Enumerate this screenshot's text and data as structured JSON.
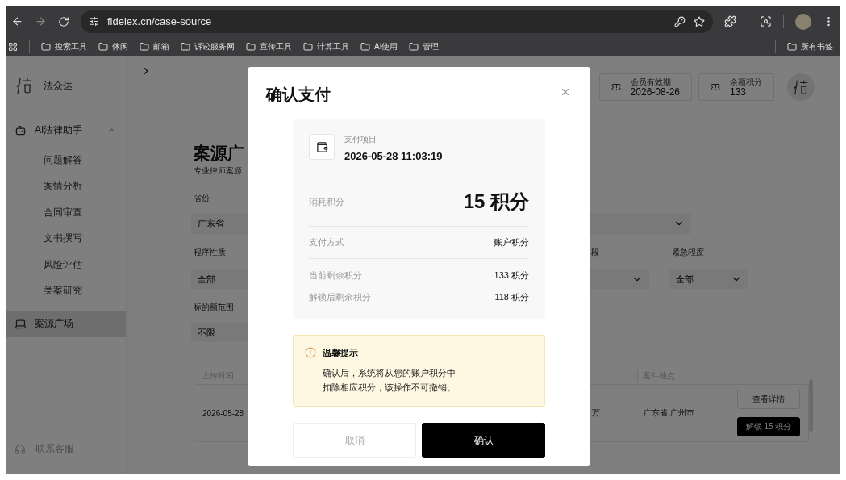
{
  "browser": {
    "url": "fidelex.cn/case-source",
    "bookmarks": [
      "搜索工具",
      "休闲",
      "邮箱",
      "诉讼服务网",
      "宣传工具",
      "计算工具",
      "AI使用",
      "管理"
    ],
    "all_bookmarks": "所有书签"
  },
  "sidebar": {
    "brand": "法众达",
    "items": [
      {
        "kind": "group",
        "label": "AI法律助手",
        "selected": false,
        "expanded": true,
        "children": [
          {
            "label": "问题解答",
            "selected": false
          },
          {
            "label": "案情分析",
            "selected": false
          },
          {
            "label": "合同审查",
            "selected": false
          },
          {
            "label": "文书撰写",
            "selected": false
          },
          {
            "label": "风险评估",
            "selected": false
          },
          {
            "label": "类案研究",
            "selected": false
          }
        ]
      },
      {
        "kind": "link",
        "label": "案源广场",
        "selected": true
      }
    ],
    "support": "联系客服"
  },
  "header": {
    "cards": [
      {
        "label": "会员有效期",
        "value": "2026-08-26"
      },
      {
        "label": "余额积分",
        "value": "133"
      }
    ]
  },
  "page": {
    "title": "案源广",
    "subtitle": "专业律师案源",
    "province": {
      "label": "省份",
      "value": "广东省"
    },
    "filters": [
      {
        "label": "程序性质",
        "value": "全部"
      },
      {
        "label": "段"
      },
      {
        "label": "紧急程度",
        "value": "全部"
      }
    ],
    "amount": {
      "label": "标的额范围",
      "value": "不限"
    },
    "table": {
      "columns": [
        {
          "label": "上传时间"
        },
        {
          "label": "案件地点"
        }
      ],
      "rows": [
        {
          "upload_time": "2026-05-28",
          "amount": "万",
          "location": "广东省 广州市",
          "actions": [
            {
              "label": "查看详情",
              "kind": "secondary"
            },
            {
              "label": "解锁 15 积分",
              "kind": "primary"
            }
          ]
        }
      ]
    }
  },
  "modal": {
    "title": "确认支付",
    "item_label": "支付项目",
    "item_value": "2026-05-28 11:03:19",
    "cost_label": "消耗积分",
    "cost_value": "15 积分",
    "method": {
      "label": "支付方式",
      "value": "账户积分"
    },
    "balances": [
      {
        "label": "当前剩余积分",
        "value": "133 积分"
      },
      {
        "label": "解锁后剩余积分",
        "value": "118 积分"
      }
    ],
    "notice": {
      "title": "温馨提示",
      "text": "确认后，系统将从您的账户积分中扣除相应积分，该操作不可撤销。"
    },
    "buttons": [
      {
        "label": "取消",
        "kind": "secondary"
      },
      {
        "label": "确认",
        "kind": "primary"
      }
    ]
  }
}
